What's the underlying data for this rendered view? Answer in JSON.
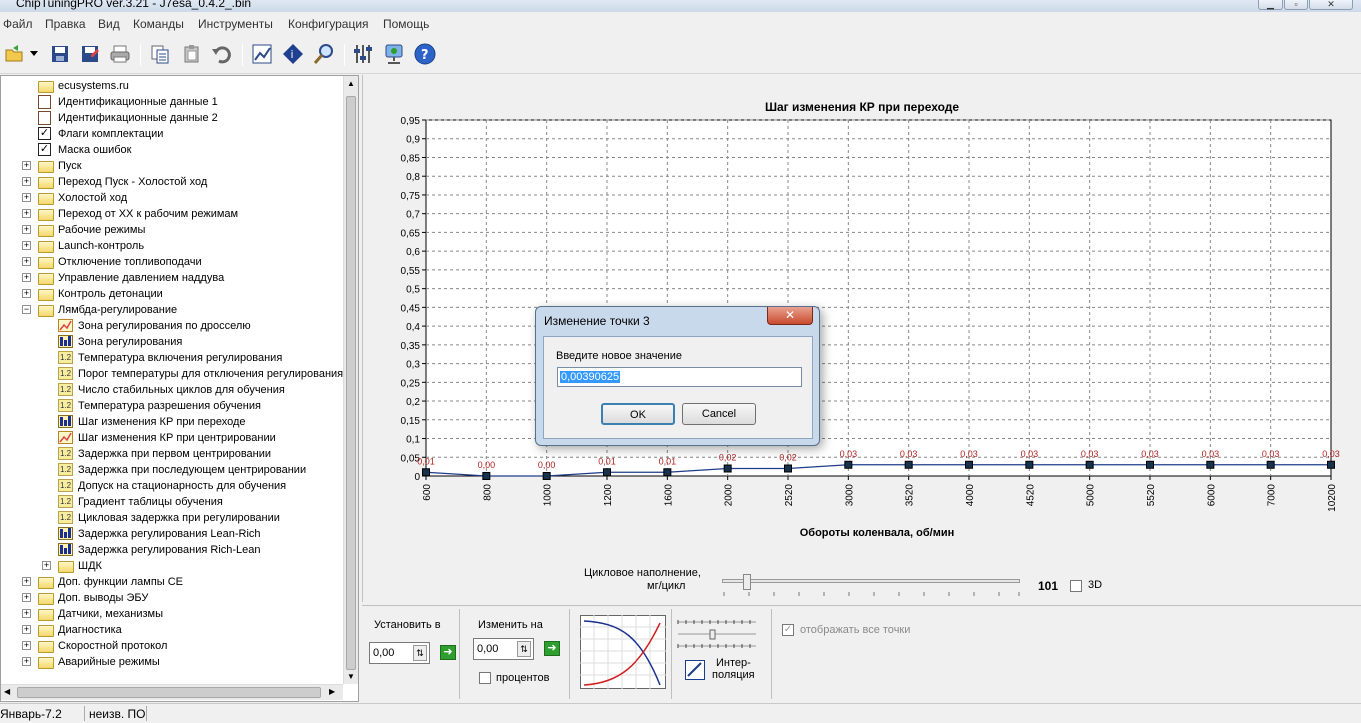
{
  "window": {
    "title": "ChipTuningPRO ver.3.21 - J7esa_0.4.2_.bin",
    "buttons": {
      "minimize": "▁",
      "maximize": "▫",
      "close": "✕"
    }
  },
  "menu": [
    "Файл",
    "Правка",
    "Вид",
    "Команды",
    "Инструменты",
    "Конфигурация",
    "Помощь"
  ],
  "toolbar": {
    "icons": [
      "open-icon",
      "save-icon",
      "save-as-icon",
      "print-icon",
      "copy-icon",
      "paste-icon",
      "undo-icon",
      "chart-icon",
      "info-icon",
      "search-icon",
      "settings-icon",
      "connect-icon",
      "help-icon"
    ]
  },
  "tree": [
    {
      "label": "ecusystems.ru",
      "icon": "folder",
      "level": 1,
      "expander": ""
    },
    {
      "label": "Идентификационные данные 1",
      "icon": "doc",
      "level": 1,
      "expander": ""
    },
    {
      "label": "Идентификационные данные 2",
      "icon": "doc",
      "level": 1,
      "expander": ""
    },
    {
      "label": "Флаги комплектации",
      "icon": "check",
      "level": 1,
      "expander": ""
    },
    {
      "label": "Маска ошибок",
      "icon": "check",
      "level": 1,
      "expander": ""
    },
    {
      "label": "Пуск",
      "icon": "folder",
      "level": 1,
      "expander": "+"
    },
    {
      "label": "Переход Пуск - Холостой ход",
      "icon": "folder",
      "level": 1,
      "expander": "+"
    },
    {
      "label": "Холостой ход",
      "icon": "folder",
      "level": 1,
      "expander": "+"
    },
    {
      "label": "Переход от ХХ к рабочим режимам",
      "icon": "folder",
      "level": 1,
      "expander": "+"
    },
    {
      "label": "Рабочие режимы",
      "icon": "folder",
      "level": 1,
      "expander": "+"
    },
    {
      "label": "Launch-контроль",
      "icon": "folder",
      "level": 1,
      "expander": "+"
    },
    {
      "label": "Отключение топливоподачи",
      "icon": "folder",
      "level": 1,
      "expander": "+"
    },
    {
      "label": "Управление давлением наддува",
      "icon": "folder",
      "level": 1,
      "expander": "+"
    },
    {
      "label": "Контроль детонации",
      "icon": "folder",
      "level": 1,
      "expander": "+"
    },
    {
      "label": "Лямбда-регулирование",
      "icon": "folder",
      "level": 1,
      "expander": "-"
    },
    {
      "label": "Зона регулирования по дросселю",
      "icon": "graph",
      "level": 2,
      "expander": ""
    },
    {
      "label": "Зона регулирования",
      "icon": "bars",
      "level": 2,
      "expander": ""
    },
    {
      "label": "Температура включения регулирования",
      "icon": "num",
      "level": 2,
      "expander": ""
    },
    {
      "label": "Порог температуры для отключения регулирования",
      "icon": "num",
      "level": 2,
      "expander": ""
    },
    {
      "label": "Число стабильных циклов для обучения",
      "icon": "num",
      "level": 2,
      "expander": ""
    },
    {
      "label": "Температура разрешения обучения",
      "icon": "num",
      "level": 2,
      "expander": ""
    },
    {
      "label": "Шаг изменения КР при переходе",
      "icon": "bars",
      "level": 2,
      "expander": ""
    },
    {
      "label": "Шаг изменения КР при центрировании",
      "icon": "graph",
      "level": 2,
      "expander": ""
    },
    {
      "label": "Задержка при первом центрировании",
      "icon": "num",
      "level": 2,
      "expander": ""
    },
    {
      "label": "Задержка при последующем центрировании",
      "icon": "num",
      "level": 2,
      "expander": ""
    },
    {
      "label": "Допуск на стационарность для обучения",
      "icon": "num",
      "level": 2,
      "expander": ""
    },
    {
      "label": "Градиент таблицы обучения",
      "icon": "num",
      "level": 2,
      "expander": ""
    },
    {
      "label": "Цикловая задержка при регулировании",
      "icon": "num",
      "level": 2,
      "expander": ""
    },
    {
      "label": "Задержка регулирования Lean-Rich",
      "icon": "bars",
      "level": 2,
      "expander": ""
    },
    {
      "label": "Задержка регулирования Rich-Lean",
      "icon": "bars",
      "level": 2,
      "expander": ""
    },
    {
      "label": "ШДК",
      "icon": "folder",
      "level": 2,
      "expander": "+"
    },
    {
      "label": "Доп. функции лампы СЕ",
      "icon": "folder",
      "level": 1,
      "expander": "+"
    },
    {
      "label": "Доп. выводы ЭБУ",
      "icon": "folder",
      "level": 1,
      "expander": "+"
    },
    {
      "label": "Датчики, механизмы",
      "icon": "folder",
      "level": 1,
      "expander": "+"
    },
    {
      "label": "Диагностика",
      "icon": "folder",
      "level": 1,
      "expander": "+"
    },
    {
      "label": "Скоростной протокол",
      "icon": "folder",
      "level": 1,
      "expander": "+"
    },
    {
      "label": "Аварийные режимы",
      "icon": "folder",
      "level": 1,
      "expander": "+"
    }
  ],
  "status": {
    "left": "Январь-7.2",
    "right": "неизв. ПО"
  },
  "chart_data": {
    "type": "line",
    "title": "Шаг изменения КР при переходе",
    "xlabel": "Обороты коленвала, об/мин",
    "ylabel": "",
    "categories": [
      "600",
      "800",
      "1000",
      "1200",
      "1600",
      "2000",
      "2520",
      "3000",
      "3520",
      "4000",
      "4520",
      "5000",
      "5520",
      "6000",
      "7000",
      "10200"
    ],
    "series": [
      {
        "values": [
          0.01,
          0.0,
          0.0,
          0.01,
          0.01,
          0.02,
          0.02,
          0.03,
          0.03,
          0.03,
          0.03,
          0.03,
          0.03,
          0.03,
          0.03,
          0.03
        ]
      }
    ],
    "data_labels": [
      "0,01",
      "0,00",
      "0,00",
      "0,01",
      "0,01",
      "0,02",
      "0,02",
      "0,03",
      "0,03",
      "0,03",
      "0,03",
      "0,03",
      "0,03",
      "0,03",
      "0,03",
      "0,03"
    ],
    "yticks": [
      "0",
      "0,05",
      "0,1",
      "0,15",
      "0,2",
      "0,25",
      "0,3",
      "0,35",
      "0,4",
      "0,45",
      "0,5",
      "0,55",
      "0,6",
      "0,65",
      "0,7",
      "0,75",
      "0,8",
      "0,85",
      "0,9",
      "0,95"
    ],
    "ylim": [
      0,
      0.95
    ],
    "grid": true,
    "colors": {
      "line": "#1f3c8a",
      "marker": "#17324d",
      "label": "#b22222"
    }
  },
  "slider": {
    "label_line1": "Цикловое наполнение,",
    "label_line2": "мг/цикл",
    "value": "101",
    "checkbox_3d": "3D"
  },
  "bottom": {
    "set_to_label": "Установить в",
    "set_to_value": "0,00",
    "change_by_label": "Изменить на",
    "change_by_value": "0,00",
    "percent_label": "процентов",
    "interp_line1": "Интер-",
    "interp_line2": "поляция",
    "show_all_points": "отображать все точки"
  },
  "dialog": {
    "title": "Изменение точки 3",
    "prompt": "Введите новое значение",
    "value": "0,00390625",
    "ok": "OK",
    "cancel": "Cancel",
    "close": "✕"
  }
}
